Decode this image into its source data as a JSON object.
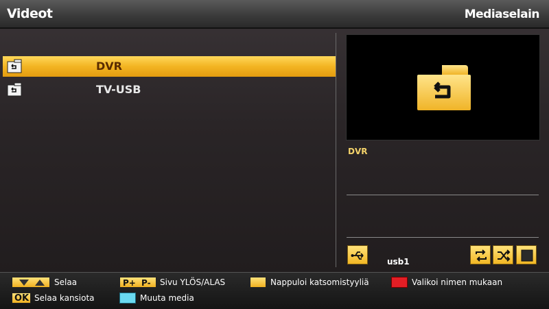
{
  "header": {
    "title": "Videot",
    "app_name": "Mediaselain"
  },
  "list": {
    "items": [
      {
        "label": "DVR",
        "icon": "folder-back-icon",
        "selected": true
      },
      {
        "label": "TV-USB",
        "icon": "folder-back-icon",
        "selected": false
      }
    ]
  },
  "preview": {
    "icon": "folder-back-icon",
    "name": "DVR"
  },
  "device": {
    "label": "usb1",
    "icon": "usb-icon"
  },
  "controls": [
    {
      "icon": "repeat-icon"
    },
    {
      "icon": "shuffle-icon"
    },
    {
      "icon": "stop-icon"
    }
  ],
  "footer": {
    "browse": {
      "label": "Selaa",
      "key_icons": [
        "arrow-down-icon",
        "arrow-up-icon"
      ]
    },
    "page": {
      "label": "Sivu YLÖS/ALAS",
      "key_p_plus": "P+",
      "key_p_minus": "P-"
    },
    "view_style": {
      "label": "Nappuloi katsomistyyliä",
      "key_color": "#f5c232"
    },
    "sort": {
      "label": "Valikoi nimen mukaan",
      "key_color": "#e31e25"
    },
    "browse_folder": {
      "label": "Selaa kansiota",
      "key": "OK"
    },
    "change_media": {
      "label": "Muuta media",
      "key_color": "#6ad9f0"
    }
  },
  "colors": {
    "accent": "#f3b422",
    "selected_text": "#5a2c00",
    "preview_name": "#f3d26a"
  }
}
